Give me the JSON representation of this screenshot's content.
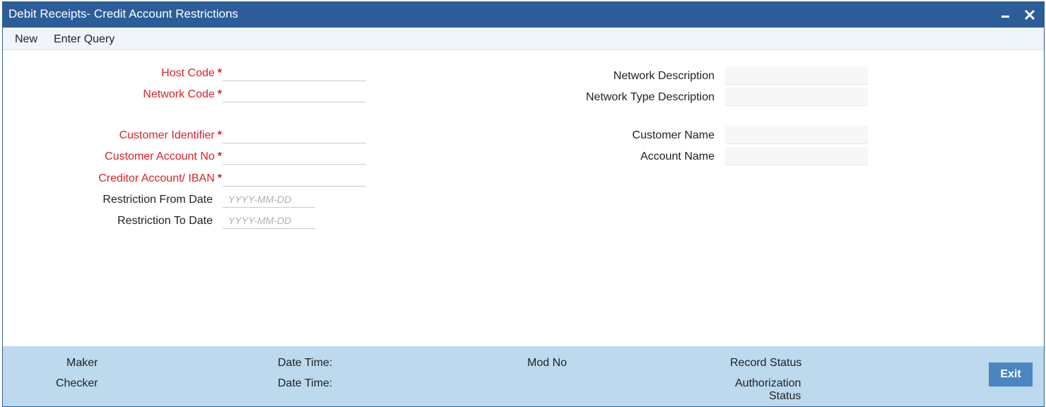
{
  "window": {
    "title": "Debit Receipts- Credit Account Restrictions"
  },
  "toolbar": {
    "new_label": "New",
    "enter_query_label": "Enter Query"
  },
  "form_left": {
    "host_code": {
      "label": "Host Code",
      "required": "*",
      "value": ""
    },
    "network_code": {
      "label": "Network Code",
      "required": "*",
      "value": ""
    },
    "customer_identifier": {
      "label": "Customer Identifier",
      "required": "*",
      "value": ""
    },
    "customer_account_no": {
      "label": "Customer Account No",
      "required": "*",
      "value": ""
    },
    "creditor_account_iban": {
      "label": "Creditor Account/ IBAN",
      "required": "*",
      "value": ""
    },
    "restriction_from_date": {
      "label": "Restriction From Date",
      "placeholder": "YYYY-MM-DD"
    },
    "restriction_to_date": {
      "label": "Restriction To Date",
      "placeholder": "YYYY-MM-DD"
    }
  },
  "form_right": {
    "network_description": {
      "label": "Network Description",
      "value": ""
    },
    "network_type_description": {
      "label": "Network Type Description",
      "value": ""
    },
    "customer_name": {
      "label": "Customer Name",
      "value": ""
    },
    "account_name": {
      "label": "Account Name",
      "value": ""
    }
  },
  "footer": {
    "maker": "Maker",
    "checker": "Checker",
    "date_time_1": "Date Time:",
    "date_time_2": "Date Time:",
    "mod_no": "Mod No",
    "record_status": "Record Status",
    "authorization": "Authorization",
    "status": "Status",
    "exit_label": "Exit"
  },
  "colors": {
    "titlebar": "#2c5d99",
    "required_label": "#d8232a",
    "footer": "#bcd9ee",
    "exit_button": "#4a86c1"
  },
  "icons": {
    "minimize": "minimize-icon",
    "close": "close-icon"
  }
}
